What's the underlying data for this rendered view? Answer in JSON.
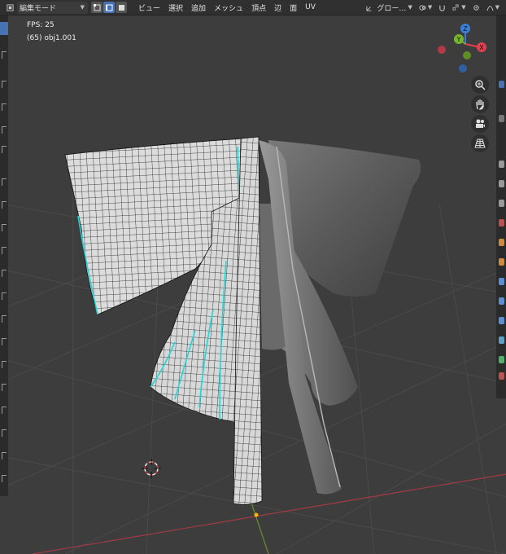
{
  "header": {
    "mode_label": "編集モード",
    "menus": [
      "ビュー",
      "選択",
      "追加",
      "メッシュ",
      "頂点",
      "辺",
      "面",
      "UV"
    ],
    "orientation_label": "グロー…"
  },
  "overlay": {
    "fps_text": "FPS: 25",
    "object_text": "(65) obj1.001"
  },
  "gizmo": {
    "z_label": "Z",
    "y_label": "Y",
    "x_label": "X"
  },
  "colors": {
    "accent": "#4772b3",
    "gizmo_x": "#e0404d",
    "gizmo_y": "#76b52f",
    "gizmo_z": "#3a7fdb",
    "selection_edge": "#22d6d6",
    "x_axis_line": "#a33a44",
    "y_axis_line": "#6b8f2d"
  },
  "icons": {
    "editor_type": "3d-viewport-icon",
    "vertex_select": "vertex-select-icon",
    "edge_select": "edge-select-icon",
    "face_select": "face-select-icon",
    "transform_orientation": "global-orientation-icon",
    "pivot": "pivot-icon",
    "snap": "magnet-icon",
    "proportional": "proportional-edit-icon",
    "zoom": "zoom-icon",
    "pan": "hand-icon",
    "camera": "camera-icon",
    "perspective": "grid-perspective-icon",
    "cursor": "3d-cursor-icon"
  }
}
